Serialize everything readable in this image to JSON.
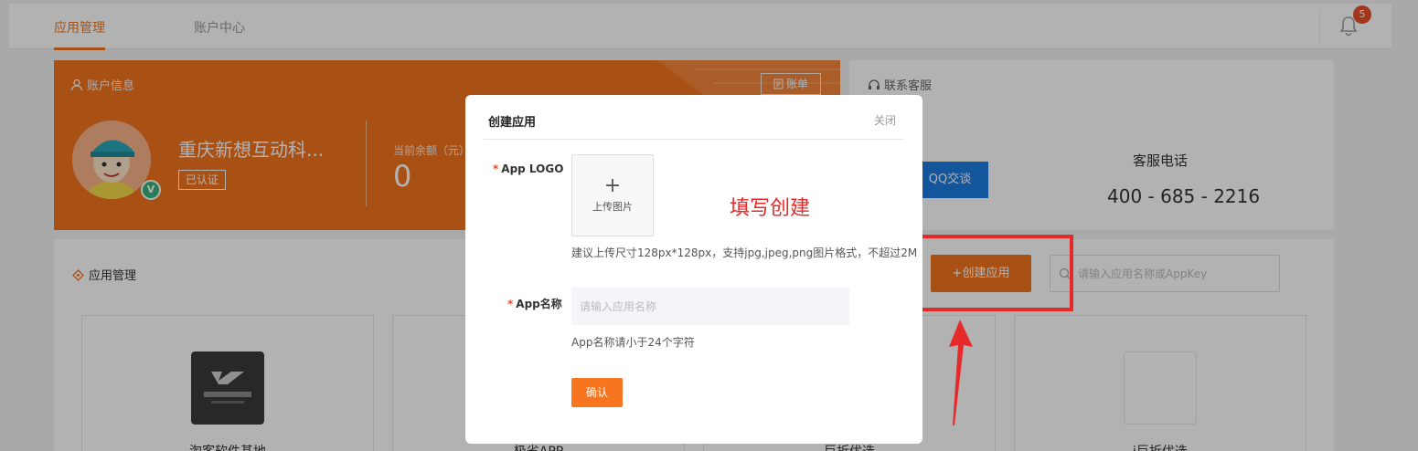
{
  "nav": {
    "tabs": [
      {
        "label": "应用管理",
        "active": true
      },
      {
        "label": "账户中心",
        "active": false
      }
    ],
    "notification_count": "5"
  },
  "account": {
    "header": "账户信息",
    "bill_button": "账单",
    "company_name": "重庆新想互动科...",
    "verified_tag": "已认证",
    "verify_badge": "V",
    "balance_label": "当前余额（元）",
    "balance_value": "0"
  },
  "contact": {
    "header": "联系客服",
    "qq_button": "QQ交谈",
    "phone_label": "客服电话",
    "phone_value": "400 - 685 - 2216"
  },
  "apps": {
    "header": "应用管理",
    "create_button": "+创建应用",
    "search_placeholder": "请输入应用名称或AppKey",
    "cards": [
      {
        "name": "淘客软件基地"
      },
      {
        "name": "极省APP"
      },
      {
        "name": "巨折优选"
      },
      {
        "name": "i巨折优选"
      }
    ]
  },
  "modal": {
    "title": "创建应用",
    "close": "关闭",
    "logo_label": "App LOGO",
    "upload_plus": "+",
    "upload_text": "上传图片",
    "logo_hint": "建议上传尺寸128px*128px，支持jpg,jpeg,png图片格式，不超过2M",
    "name_label": "App名称",
    "name_placeholder": "请输入应用名称",
    "name_hint": "App名称请小于24个字符",
    "confirm": "确认",
    "required_mark": "*"
  },
  "annotation": {
    "text": "填写创建",
    "color": "#e62a2a"
  },
  "colors": {
    "accent": "#f3741f",
    "qq_blue": "#1e7ce0",
    "badge_red": "#e8502b"
  }
}
